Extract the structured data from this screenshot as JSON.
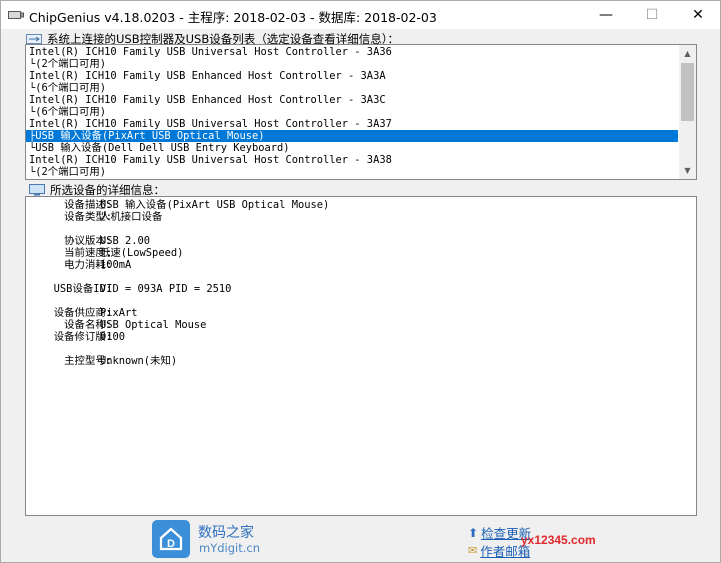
{
  "window": {
    "title": "ChipGenius v4.18.0203 - 主程序: 2018-02-03 - 数据库: 2018-02-03",
    "minimize": "—",
    "maximize": "☐",
    "close": "✕"
  },
  "device_list": {
    "label": "系统上连接的USB控制器及USB设备列表（选定设备查看详细信息）：",
    "items": [
      "Intel(R) ICH10 Family USB Universal Host Controller - 3A36",
      "└(2个端口可用)",
      "Intel(R) ICH10 Family USB Enhanced Host Controller - 3A3A",
      "└(6个端口可用)",
      "Intel(R) ICH10 Family USB Enhanced Host Controller - 3A3C",
      "└(6个端口可用)",
      "Intel(R) ICH10 Family USB Universal Host Controller - 3A37",
      "├USB 输入设备(PixArt USB Optical Mouse)",
      "└USB 输入设备(Dell Dell USB Entry Keyboard)",
      "Intel(R) ICH10 Family USB Universal Host Controller - 3A38",
      "└(2个端口可用)"
    ],
    "selected_index": 7
  },
  "details": {
    "label": "所选设备的详细信息：",
    "rows": [
      {
        "label": "设备描述:",
        "value": "USB 输入设备(PixArt USB Optical Mouse)"
      },
      {
        "label": "设备类型:",
        "value": "人机接口设备"
      },
      {
        "label": "",
        "value": ""
      },
      {
        "label": "协议版本:",
        "value": "USB 2.00"
      },
      {
        "label": "当前速度:",
        "value": "低速(LowSpeed)"
      },
      {
        "label": "电力消耗:",
        "value": "100mA"
      },
      {
        "label": "",
        "value": ""
      },
      {
        "label": "USB设备ID:",
        "value": "VID = 093A PID = 2510"
      },
      {
        "label": "",
        "value": ""
      },
      {
        "label": "设备供应商:",
        "value": "PixArt"
      },
      {
        "label": "设备名称:",
        "value": "USB Optical Mouse"
      },
      {
        "label": "设备修订版:",
        "value": "0100"
      },
      {
        "label": "",
        "value": ""
      },
      {
        "label": "主控型号:",
        "value": "Unknown(未知)"
      }
    ]
  },
  "footer": {
    "brand_name": "数码之家",
    "brand_url": "mYdigit.cn",
    "check_update": "检查更新",
    "author_email": "作者邮箱",
    "watermark": "yx12345.com"
  }
}
